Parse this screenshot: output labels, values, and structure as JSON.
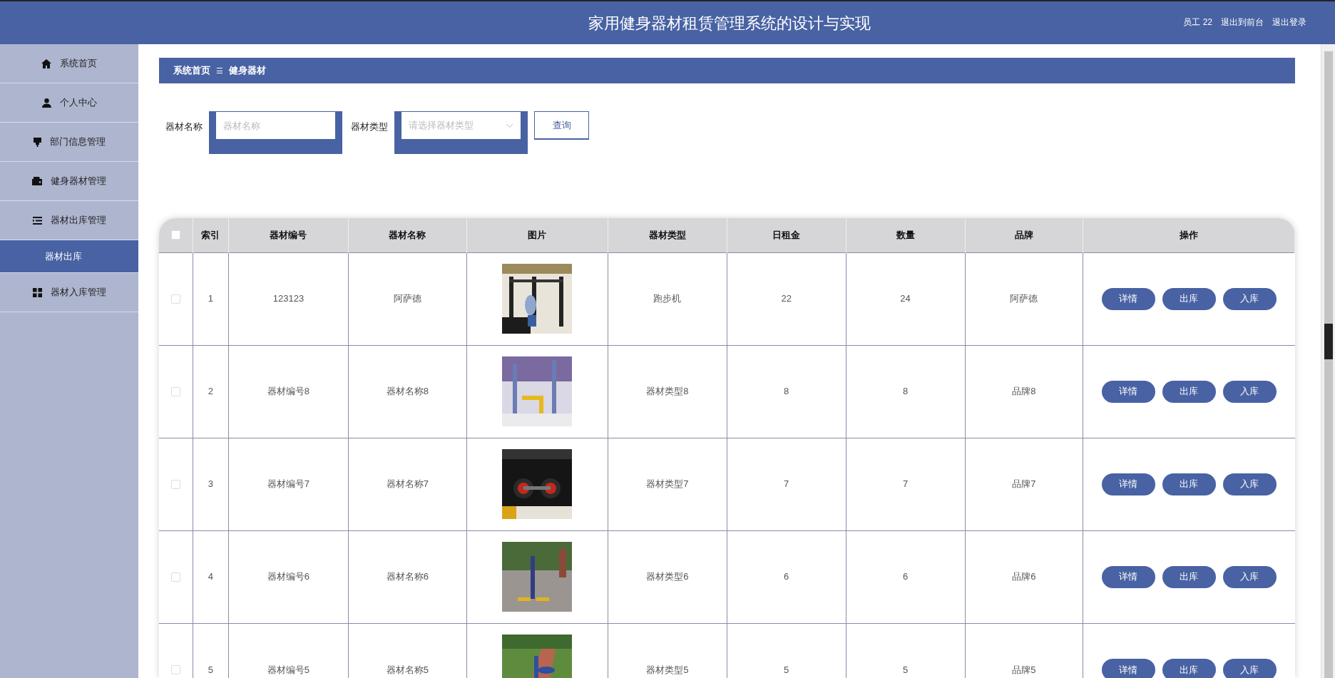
{
  "header": {
    "title": "家用健身器材租赁管理系统的设计与实现",
    "user": "员工 22",
    "links": [
      "退出到前台",
      "退出登录"
    ]
  },
  "sidebar": {
    "items": [
      {
        "label": "系统首页",
        "selected": false
      },
      {
        "label": "个人中心",
        "selected": false
      },
      {
        "label": "部门信息管理",
        "selected": false
      },
      {
        "label": "健身器材管理",
        "selected": false
      },
      {
        "label": "器材出库管理",
        "selected": false,
        "expanded": true,
        "children": [
          {
            "label": "器材出库",
            "selected": true
          }
        ]
      },
      {
        "label": "器材入库管理",
        "selected": false
      }
    ]
  },
  "breadcrumb": {
    "items": [
      "系统首页",
      "健身器材"
    ],
    "separator": "☰"
  },
  "search": {
    "fields": [
      {
        "kind": "text",
        "label": "器材名称",
        "placeholder": "器材名称"
      },
      {
        "kind": "select",
        "label": "器材类型",
        "placeholder": "请选择器材类型"
      }
    ],
    "button": "查询"
  },
  "table": {
    "all_checked": false,
    "columns": [
      "索引",
      "器材编号",
      "器材名称",
      "图片",
      "器材类型",
      "日租金",
      "数量",
      "品牌",
      "操作"
    ],
    "rows": [
      {
        "checked": false,
        "index": "1",
        "code": "123123",
        "name": "阿萨德",
        "type": "跑步机",
        "rent": "22",
        "qty": "24",
        "brand": "阿萨德",
        "actions": [
          "详情",
          "出库",
          "入库"
        ]
      },
      {
        "checked": false,
        "index": "2",
        "code": "器材编号8",
        "name": "器材名称8",
        "type": "器材类型8",
        "rent": "8",
        "qty": "8",
        "brand": "品牌8",
        "actions": [
          "详情",
          "出库",
          "入库"
        ]
      },
      {
        "checked": false,
        "index": "3",
        "code": "器材编号7",
        "name": "器材名称7",
        "type": "器材类型7",
        "rent": "7",
        "qty": "7",
        "brand": "品牌7",
        "actions": [
          "详情",
          "出库",
          "入库"
        ]
      },
      {
        "checked": false,
        "index": "4",
        "code": "器材编号6",
        "name": "器材名称6",
        "type": "器材类型6",
        "rent": "6",
        "qty": "6",
        "brand": "品牌6",
        "actions": [
          "详情",
          "出库",
          "入库"
        ]
      },
      {
        "checked": false,
        "index": "5",
        "code": "器材编号5",
        "name": "器材名称5",
        "type": "器材类型5",
        "rent": "5",
        "qty": "5",
        "brand": "品牌5",
        "actions": [
          "详情",
          "出库",
          "入库"
        ]
      }
    ]
  }
}
